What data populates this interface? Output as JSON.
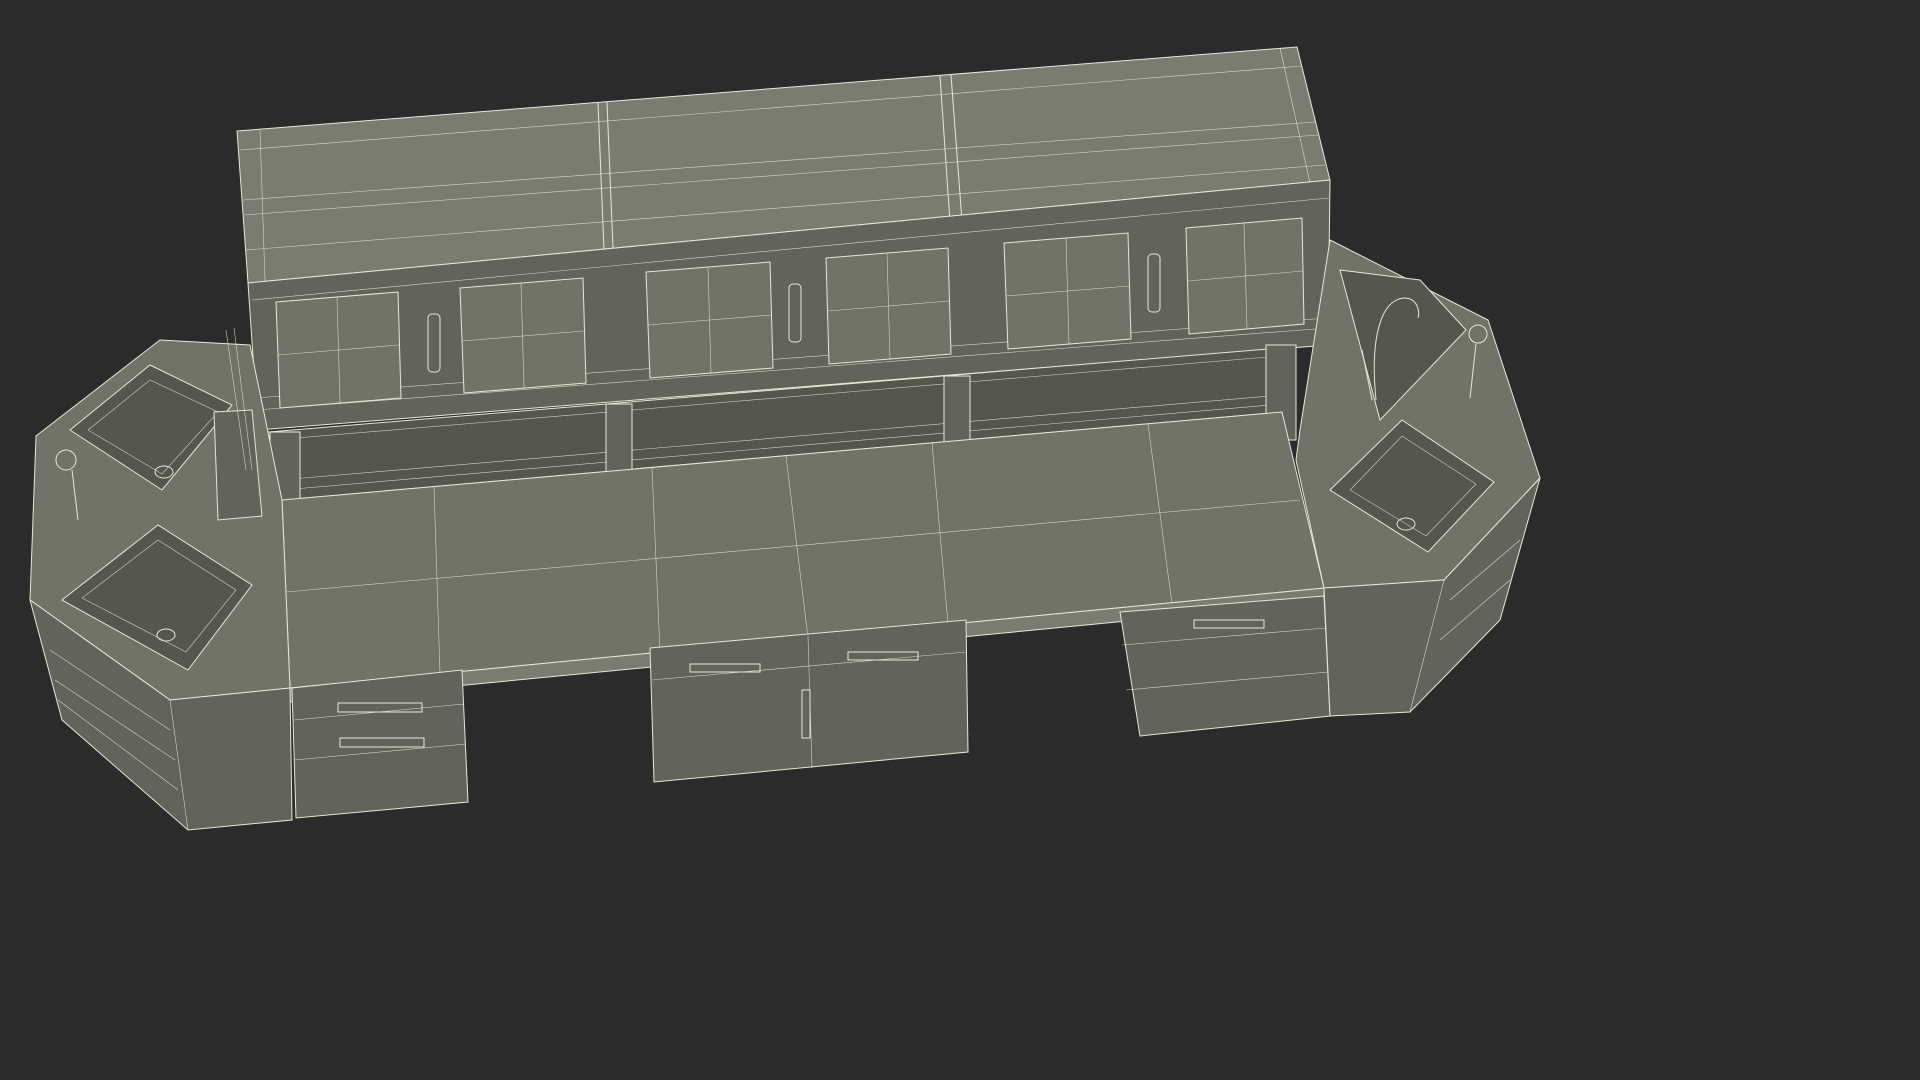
{
  "scene": {
    "subject": "",
    "background_color": "#2b2b2b",
    "surface_color": "#6e6f65",
    "surface_dark_color": "#5c5d54",
    "surface_light_color": "#7c7d72",
    "wire_color": "#e9e8d6"
  }
}
